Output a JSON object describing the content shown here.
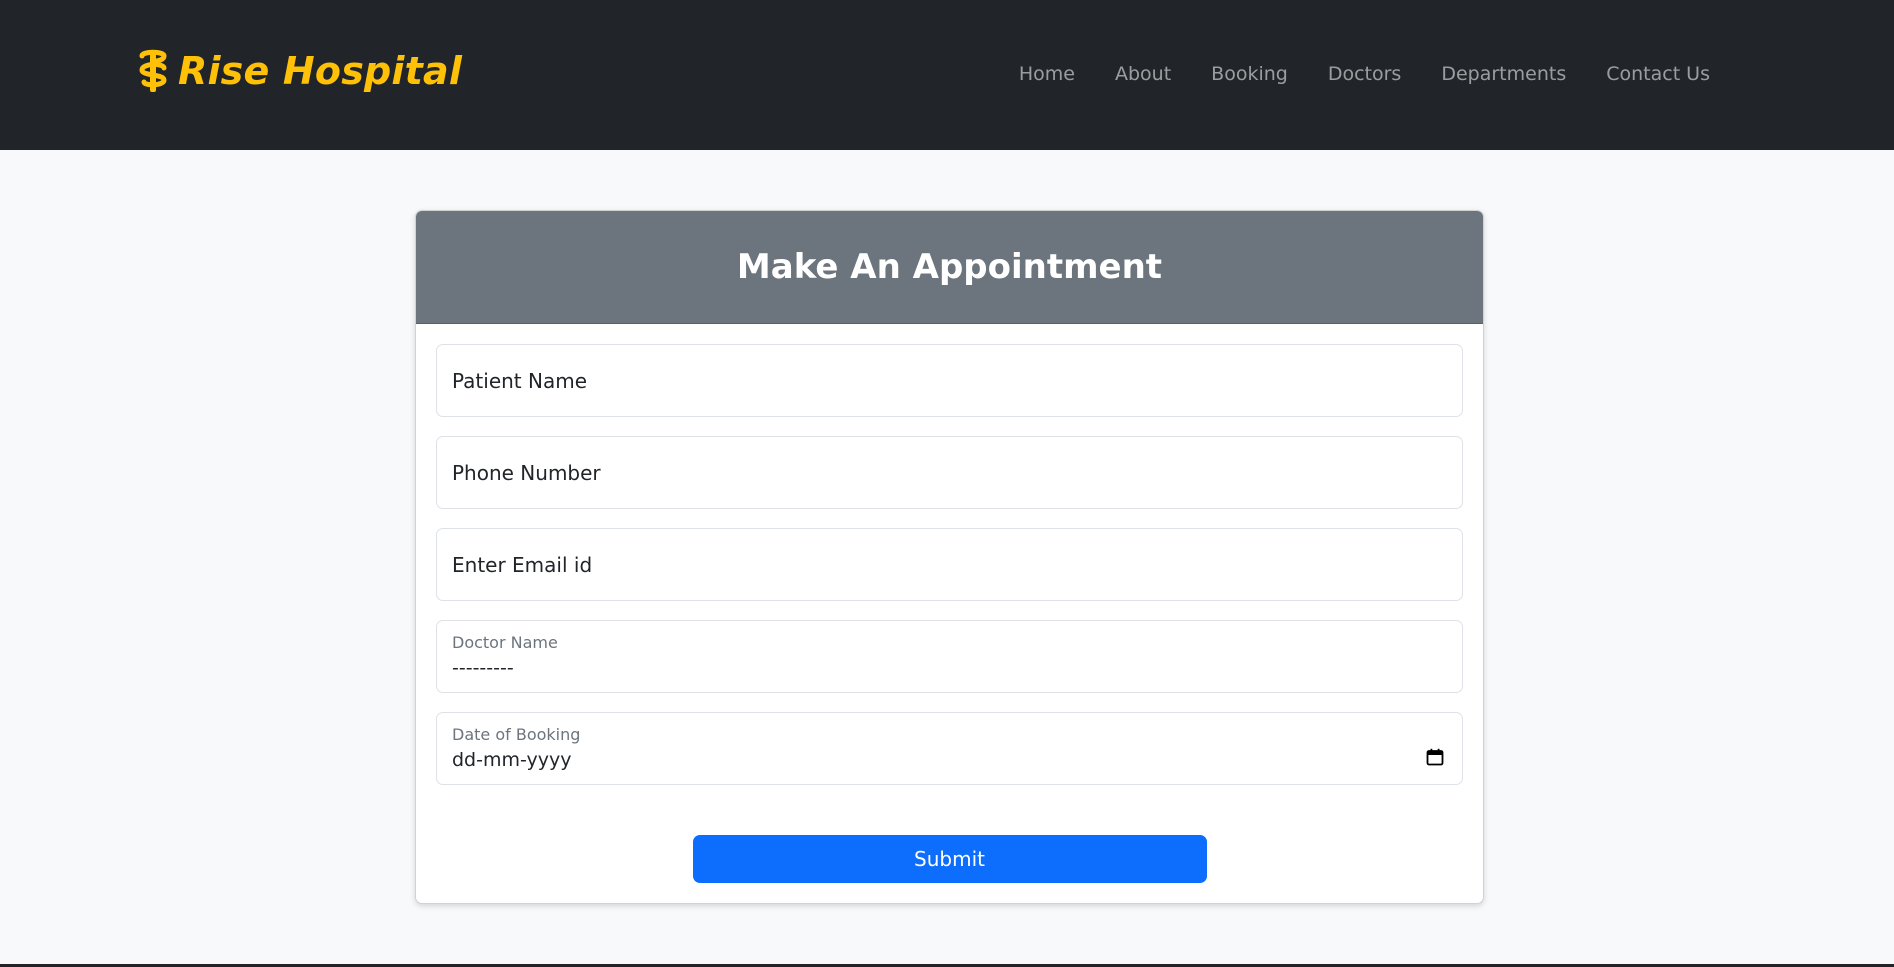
{
  "navbar": {
    "brand": "Rise Hospital",
    "brand_icon": "caduceus-icon",
    "brand_color": "#ffc107",
    "background": "#212529",
    "links": [
      {
        "label": "Home"
      },
      {
        "label": "About"
      },
      {
        "label": "Booking"
      },
      {
        "label": "Doctors"
      },
      {
        "label": "Departments"
      },
      {
        "label": "Contact Us"
      }
    ]
  },
  "form": {
    "title": "Make An Appointment",
    "header_color": "#6c757d",
    "patient_name": {
      "placeholder": "Patient Name",
      "value": ""
    },
    "phone": {
      "placeholder": "Phone Number",
      "value": ""
    },
    "email": {
      "placeholder": "Enter Email id",
      "value": ""
    },
    "doctor": {
      "label": "Doctor Name",
      "selected": "---------"
    },
    "date": {
      "label": "Date of Booking",
      "value": "dd-mm-yyyy",
      "icon": "calendar-icon"
    },
    "submit_label": "Submit",
    "submit_color": "#0d6efd"
  }
}
